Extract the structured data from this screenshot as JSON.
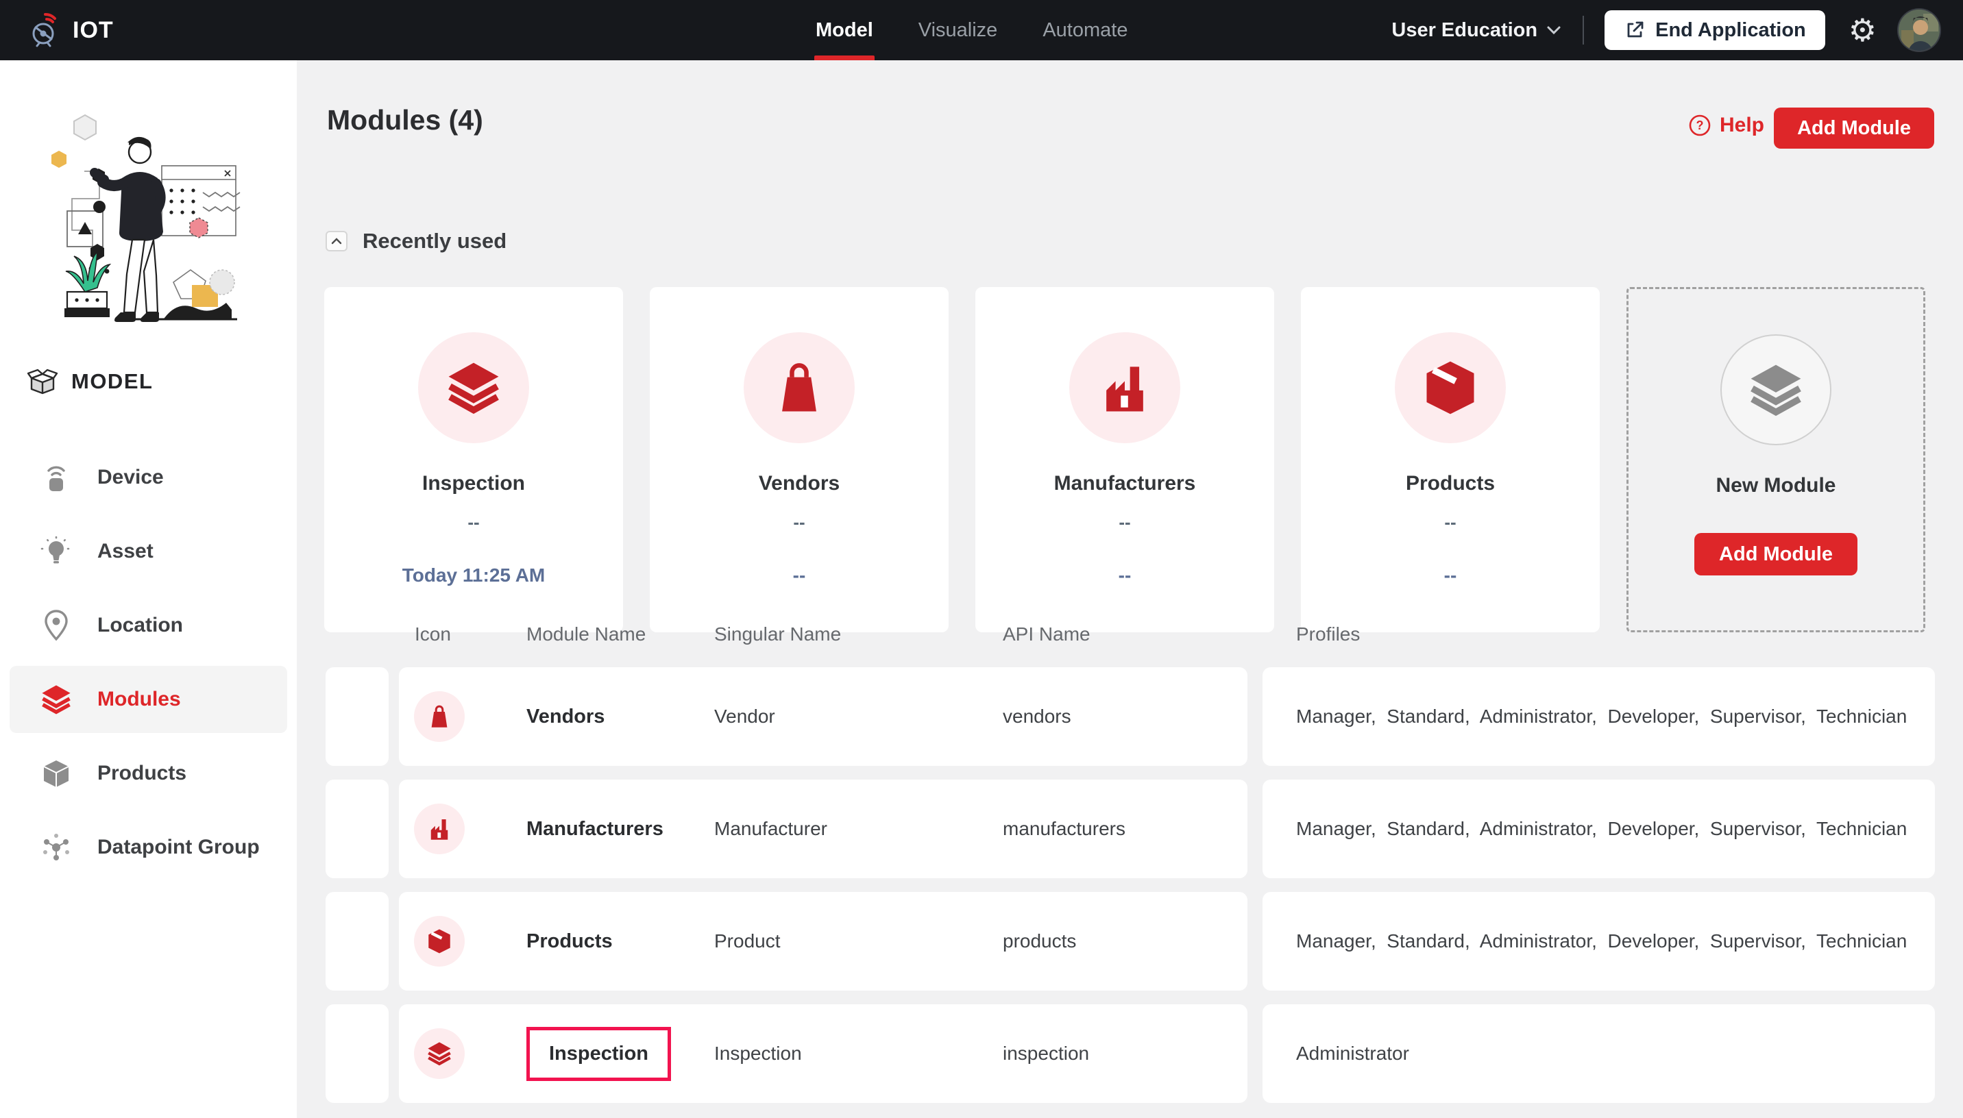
{
  "colors": {
    "navbar-bg": "#16181c",
    "page-bg": "#f1f1f2",
    "accent-red": "#de2629",
    "icon-red": "#c42127",
    "highlight-pink": "#f2134f",
    "icon-circle-bg": "#fdecee",
    "timestamp-blue": "#5c6f96"
  },
  "navbar": {
    "brand": "IOT",
    "tabs": [
      {
        "label": "Model",
        "active": true
      },
      {
        "label": "Visualize",
        "active": false
      },
      {
        "label": "Automate",
        "active": false
      }
    ],
    "app_name": "User Education",
    "end_application_label": "End Application"
  },
  "sidebar": {
    "section_label": "MODEL",
    "items": [
      {
        "label": "Device",
        "icon": "device-icon"
      },
      {
        "label": "Asset",
        "icon": "asset-icon"
      },
      {
        "label": "Location",
        "icon": "location-icon"
      },
      {
        "label": "Modules",
        "icon": "layers-icon",
        "active": true
      },
      {
        "label": "Products",
        "icon": "box-icon"
      },
      {
        "label": "Datapoint Group",
        "icon": "datapoint-group-icon"
      }
    ]
  },
  "header": {
    "title": "Modules (4)",
    "help_label": "Help",
    "add_module_label": "Add Module"
  },
  "recently_used": {
    "label": "Recently used",
    "collapsed": false
  },
  "cards": [
    {
      "name": "Inspection",
      "icon": "layers-icon",
      "line1": "--",
      "line2": "Today 11:25 AM"
    },
    {
      "name": "Vendors",
      "icon": "bag-icon",
      "line1": "--",
      "line2": "--"
    },
    {
      "name": "Manufacturers",
      "icon": "factory-icon",
      "line1": "--",
      "line2": "--"
    },
    {
      "name": "Products",
      "icon": "box-icon",
      "line1": "--",
      "line2": "--"
    }
  ],
  "new_module_card": {
    "name": "New Module",
    "button_label": "Add Module",
    "icon": "layers-icon"
  },
  "table": {
    "columns": {
      "icon": "Icon",
      "module": "Module Name",
      "singular": "Singular Name",
      "api": "API Name",
      "profiles": "Profiles"
    },
    "rows": [
      {
        "icon": "bag-icon",
        "module_name": "Vendors",
        "singular_name": "Vendor",
        "api_name": "vendors",
        "profiles": "Manager,  Standard,  Administrator,  Developer,  Supervisor,  Technician",
        "highlighted": false
      },
      {
        "icon": "factory-icon",
        "module_name": "Manufacturers",
        "singular_name": "Manufacturer",
        "api_name": "manufacturers",
        "profiles": "Manager,  Standard,  Administrator,  Developer,  Supervisor,  Technician",
        "highlighted": false
      },
      {
        "icon": "box-icon",
        "module_name": "Products",
        "singular_name": "Product",
        "api_name": "products",
        "profiles": "Manager,  Standard,  Administrator,  Developer,  Supervisor,  Technician",
        "highlighted": false
      },
      {
        "icon": "layers-icon",
        "module_name": "Inspection",
        "singular_name": "Inspection",
        "api_name": "inspection",
        "profiles": "Administrator",
        "highlighted": true
      }
    ]
  }
}
